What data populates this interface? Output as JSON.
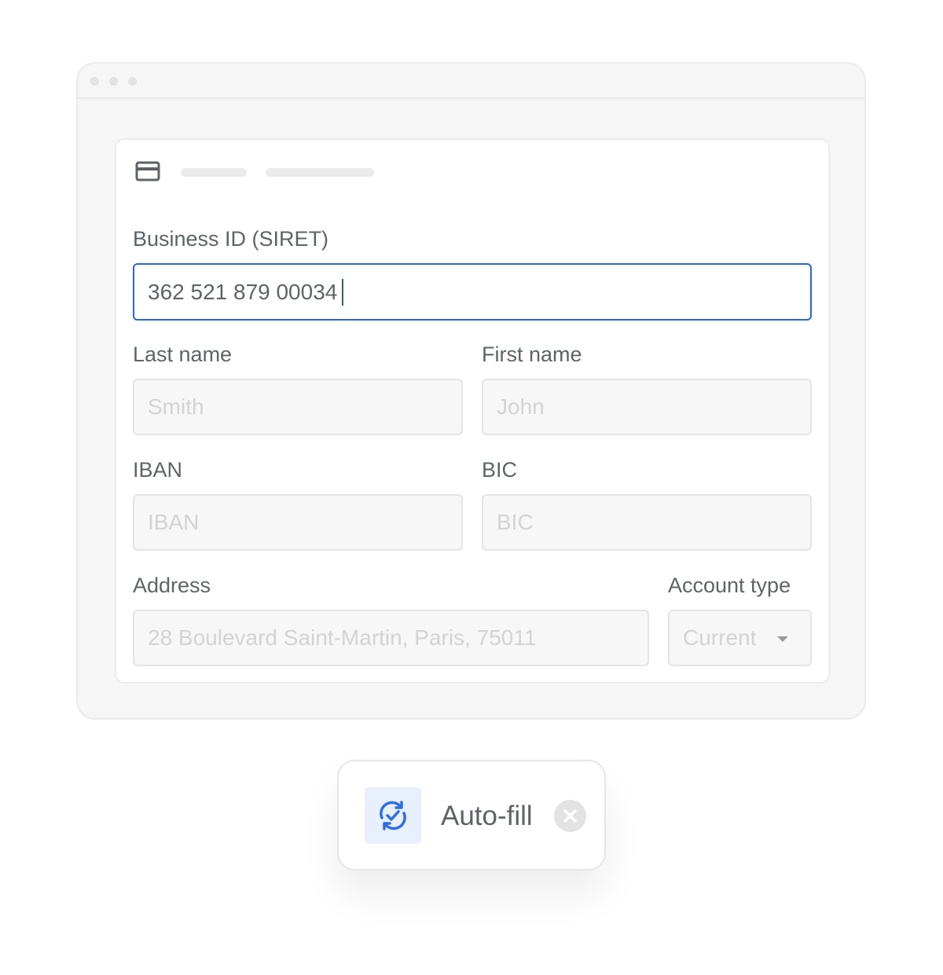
{
  "window": {
    "dots": [
      "dot",
      "dot",
      "dot"
    ]
  },
  "form": {
    "header_icon": "credit-card-icon",
    "business_id": {
      "label": "Business ID (SIRET)",
      "value": "362 521 879 00034"
    },
    "last_name": {
      "label": "Last name",
      "placeholder": "Smith"
    },
    "first_name": {
      "label": "First name",
      "placeholder": "John"
    },
    "iban": {
      "label": "IBAN",
      "placeholder": "IBAN"
    },
    "bic": {
      "label": "BIC",
      "placeholder": "BIC"
    },
    "address": {
      "label": "Address",
      "placeholder": "28 Boulevard Saint-Martin, Paris, 75011"
    },
    "account_type": {
      "label": "Account type",
      "selected": "Current"
    }
  },
  "autofill": {
    "icon": "sync-check-icon",
    "label": "Auto-fill",
    "close_icon": "close-icon"
  },
  "colors": {
    "accent": "#2b64d6",
    "icon_blue": "#2f6ee6",
    "icon_bg": "#e8f0fe"
  }
}
